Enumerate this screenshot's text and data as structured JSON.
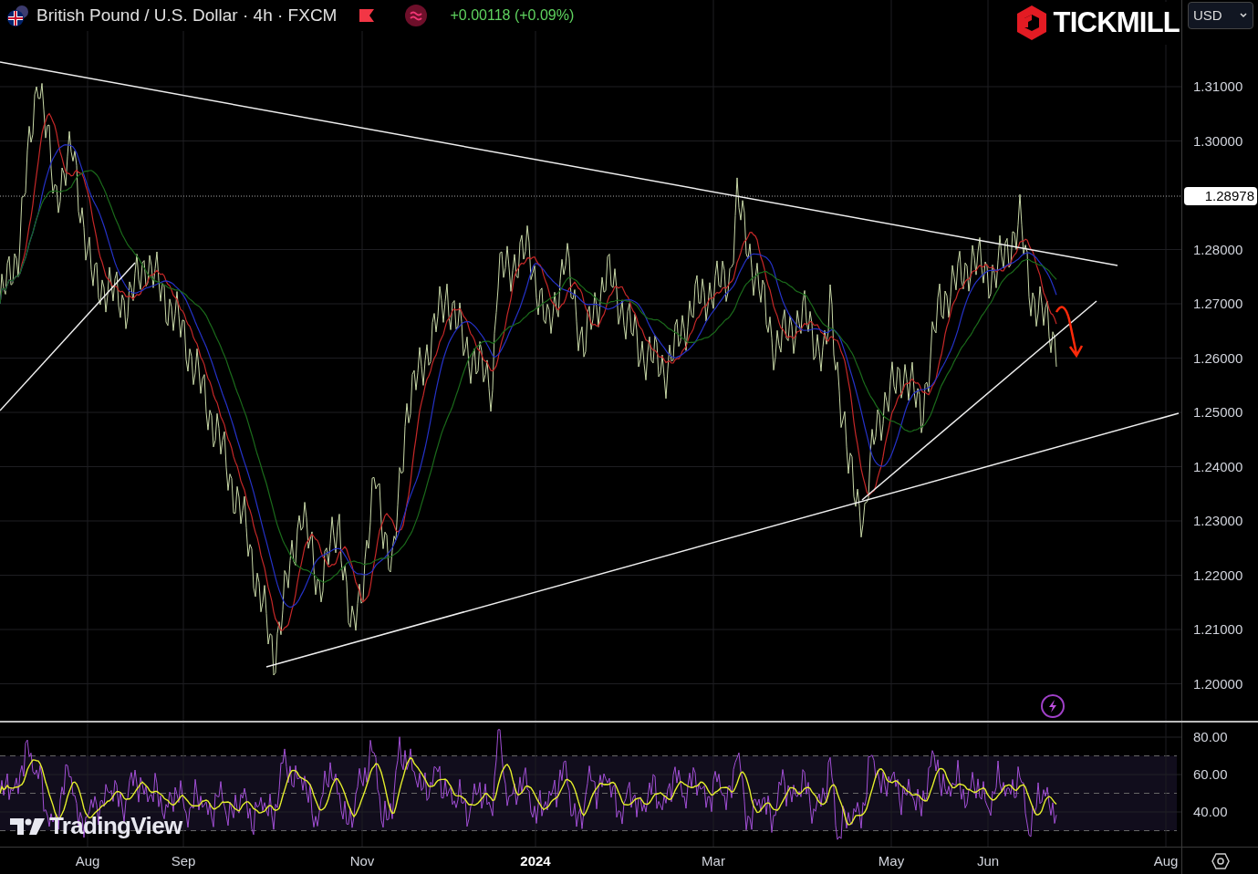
{
  "header": {
    "title": "British Pound / U.S. Dollar · 4h · FXCM",
    "change": "+0.00118 (+0.09%)"
  },
  "logo": {
    "text": "TICKMILL"
  },
  "currency_select": {
    "value": "USD"
  },
  "price_axis": {
    "labels": [
      "1.31000",
      "1.30000",
      "1.28000",
      "1.27000",
      "1.26000",
      "1.25000",
      "1.24000",
      "1.23000",
      "1.22000",
      "1.21000",
      "1.20000"
    ],
    "last_price": "1.28978"
  },
  "rsi_axis": {
    "labels": [
      "80.00",
      "60.00",
      "40.00"
    ]
  },
  "time_axis": {
    "labels": [
      {
        "text": "Aug",
        "emphasized": false
      },
      {
        "text": "Sep",
        "emphasized": false
      },
      {
        "text": "Nov",
        "emphasized": false
      },
      {
        "text": "2024",
        "emphasized": true
      },
      {
        "text": "Mar",
        "emphasized": false
      },
      {
        "text": "May",
        "emphasized": false
      },
      {
        "text": "Jun",
        "emphasized": false
      },
      {
        "text": "Aug",
        "emphasized": false
      }
    ]
  },
  "watermark": {
    "text": "TradingView"
  }
}
